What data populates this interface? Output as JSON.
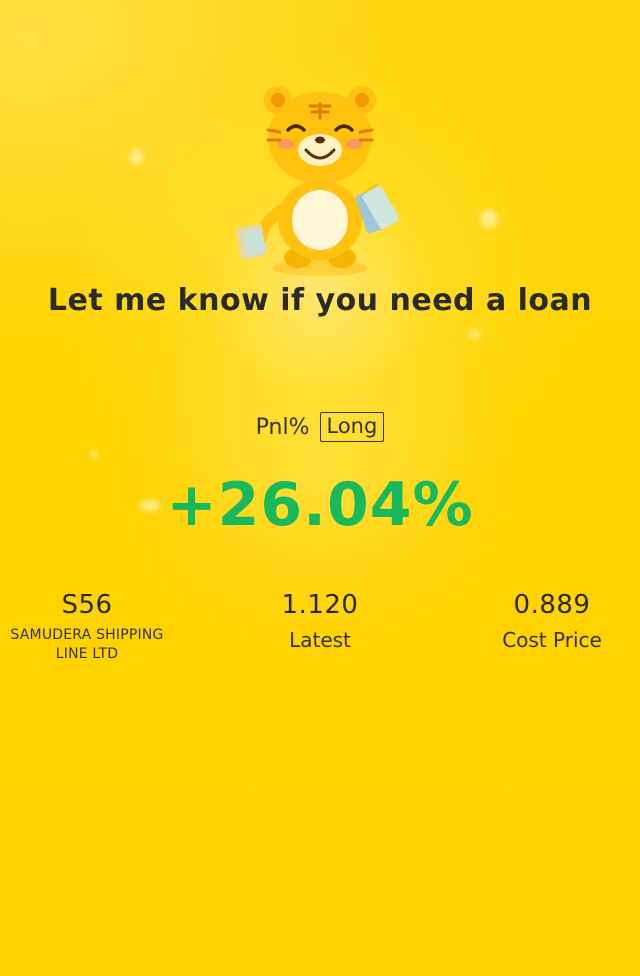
{
  "headline": "Let me know if you need a loan",
  "pnl": {
    "label": "Pnl%",
    "position_type": "Long",
    "value": "+26.04%",
    "value_color": "#17b85e"
  },
  "stock": {
    "symbol": "S56",
    "name": "SAMUDERA SHIPPING LINE LTD"
  },
  "latest": {
    "value": "1.120",
    "label": "Latest"
  },
  "cost": {
    "value": "0.889",
    "label": "Cost Price"
  },
  "mascot": {
    "icon": "tiger-mascot-icon"
  },
  "theme": {
    "background": "#ffd400",
    "text": "#2a2a2a"
  }
}
